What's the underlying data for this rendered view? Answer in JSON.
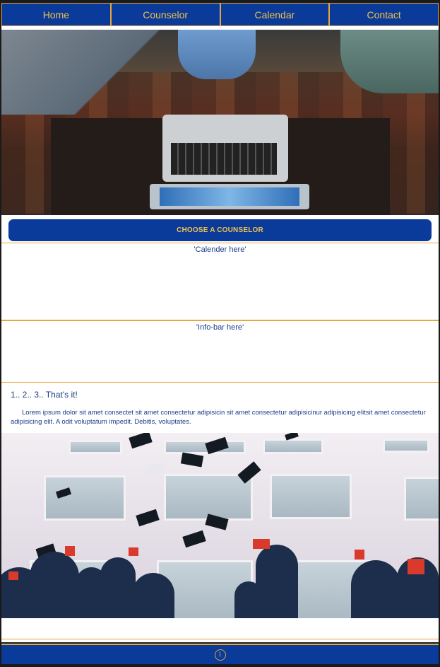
{
  "nav": {
    "items": [
      {
        "label": "Home"
      },
      {
        "label": "Counselor"
      },
      {
        "label": "Calendar"
      },
      {
        "label": "Contact"
      }
    ]
  },
  "hero": {
    "image": "students-laptop-photo"
  },
  "cta": {
    "label": "CHOOSE A COUNSELOR"
  },
  "calendar": {
    "placeholder": "'Calender here'"
  },
  "infobar": {
    "placeholder": "'Info-bar here'"
  },
  "steps": {
    "title": "1.. 2.. 3.. That's it!",
    "body": "Lorem ipsum dolor sit amet consectet sit amet consectetur adipisicin sit amet consectetur adipisicinur adipisicing elitsit amet consectetur adipisicing elit. A odit voluptatum impedit. Debitis, voluptates."
  },
  "graduation": {
    "image": "graduation-caps-photo"
  },
  "footer": {
    "icon": "info-icon"
  },
  "colors": {
    "primary": "#0a3a9a",
    "accent": "#e7a63f",
    "text": "#1b3c8a"
  }
}
